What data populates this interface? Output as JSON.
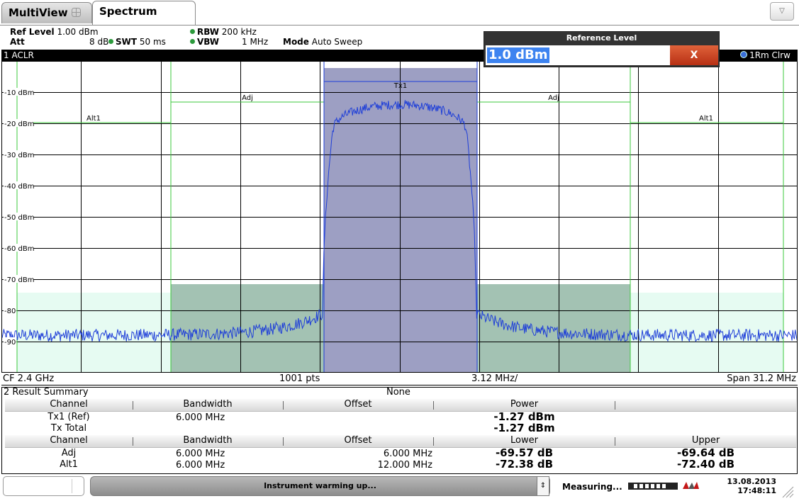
{
  "tabs": {
    "multiview": "MultiView",
    "spectrum": "Spectrum"
  },
  "settings": {
    "ref_level_label": "Ref Level",
    "ref_level_value": "1.00 dBm",
    "att_label": "Att",
    "att_value": "8 dB",
    "swt_label": "SWT",
    "swt_value": "50 ms",
    "rbw_label": "RBW",
    "rbw_value": "200 kHz",
    "vbw_label": "VBW",
    "vbw_value": "1 MHz",
    "mode_label": "Mode",
    "mode_value": "Auto Sweep"
  },
  "ref_level_dialog": {
    "title": "Reference Level",
    "value": "1.0 dBm",
    "close_label": "X"
  },
  "window1": {
    "title": "1 ACLR",
    "trace_legend": "1Rm Clrw",
    "footer": {
      "cf": "CF 2.4 GHz",
      "pts": "1001 pts",
      "div": "3.12 MHz/",
      "span": "Span 31.2 MHz"
    }
  },
  "chart_data": {
    "type": "line",
    "ylabels": [
      "-10 dBm",
      "-20 dBm",
      "-30 dBm",
      "-40 dBm",
      "-50 dBm",
      "-60 dBm",
      "-70 dBm",
      "-80",
      "-90"
    ],
    "channel_labels": {
      "tx1": "Tx1",
      "adj_left": "Adj",
      "adj_right": "Adj",
      "alt_left": "Alt1",
      "alt_right": "Alt1"
    },
    "x_unit": "MHz offset from CF",
    "x_range": [
      -15.6,
      15.6
    ],
    "y_range": [
      0,
      -100
    ],
    "channels": [
      {
        "name": "Alt1",
        "from": -15,
        "to": -9
      },
      {
        "name": "Adj",
        "from": -9,
        "to": -3
      },
      {
        "name": "Tx1",
        "from": -3,
        "to": 3
      },
      {
        "name": "Adj",
        "from": 3,
        "to": 9
      },
      {
        "name": "Alt1",
        "from": 9,
        "to": 15
      }
    ],
    "limit_lines_dbm": {
      "tx1": 1,
      "adj": -11,
      "alt1": -19
    },
    "approx_trace": {
      "noise_floor_dbm": -88,
      "in_band_level_dbm": -14,
      "edge_points_mhz": [
        -3,
        -2.6,
        2.6,
        3
      ],
      "edge_levels_dbm": [
        -80,
        -21,
        -21,
        -80
      ]
    }
  },
  "result_summary": {
    "title": "2 Result Summary",
    "mode": "None",
    "header1": [
      "Channel",
      "Bandwidth",
      "Offset",
      "Power"
    ],
    "rows1": [
      {
        "channel": "Tx1 (Ref)",
        "bandwidth": "6.000 MHz",
        "power": "-1.27 dBm"
      },
      {
        "channel": "Tx Total",
        "bandwidth": "",
        "power": "-1.27 dBm"
      }
    ],
    "header2": [
      "Channel",
      "Bandwidth",
      "Offset",
      "Lower",
      "Upper"
    ],
    "rows2": [
      {
        "channel": "Adj",
        "bandwidth": "6.000 MHz",
        "offset": "6.000 MHz",
        "lower": "-69.57 dB",
        "upper": "-69.64 dB"
      },
      {
        "channel": "Alt1",
        "bandwidth": "6.000 MHz",
        "offset": "12.000 MHz",
        "lower": "-72.38 dB",
        "upper": "-72.40 dB"
      }
    ]
  },
  "status": {
    "message": "Instrument warming up...",
    "measuring": "Measuring...",
    "date": "13.08.2013",
    "time": "17:48:11"
  },
  "colors": {
    "tx_fill": "#9d9fc3",
    "adj_fill": "#a3c2b3",
    "alt_fill": "#e6fbf2",
    "trace": "#1f3fd8",
    "limit": "#3cc83c"
  }
}
